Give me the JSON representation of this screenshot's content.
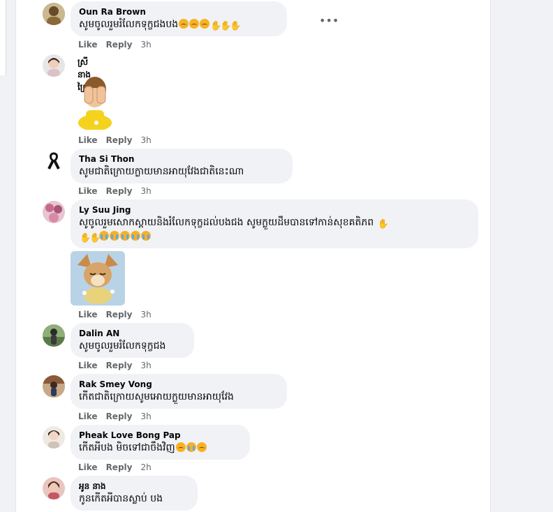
{
  "comments": [
    {
      "name": "Oun Ra Brown",
      "text": "សូមចូលរួមរំលែកទុក្ខជងបង",
      "actions": {
        "like": "Like",
        "reply": "Reply",
        "time": "3h"
      }
    },
    {
      "name": "ស្រីនាង ព្រៃវែង",
      "actions": {
        "like": "Like",
        "reply": "Reply",
        "time": "3h"
      }
    },
    {
      "name": "Tha Si Thon",
      "text": "សូមជាតិក្រោយក្លាយមានអាយុវែងជាតិនេះណា",
      "actions": {
        "like": "Like",
        "reply": "Reply",
        "time": "3h"
      }
    },
    {
      "name": "Ly Suu Jing",
      "text": "សូចូលរួមសោកស្ដាយនិងរំលែកទុក្ខដល់បងជង សូមក្លួយដឹមបានទៅកាន់សុខគតិភព",
      "actions": {
        "like": "Like",
        "reply": "Reply",
        "time": "3h"
      }
    },
    {
      "name": "Dalin AN",
      "text": "សូមចូលរួមរំលែកទុក្ខជង",
      "actions": {
        "like": "Like",
        "reply": "Reply",
        "time": "3h"
      }
    },
    {
      "name": "Rak Smey Vong",
      "text": "កើតជាតិក្រោយសូមអោយក្លួយមានអាយុវែង",
      "actions": {
        "like": "Like",
        "reply": "Reply",
        "time": "3h"
      }
    },
    {
      "name": "Pheak Love Bong Pap",
      "text": "កើតអីបង មិចទៅជាចឹងវិញ",
      "actions": {
        "like": "Like",
        "reply": "Reply",
        "time": "2h"
      }
    },
    {
      "name": "អូន នាង",
      "text": "កូនកើតអីបានស្លាប់ បង"
    }
  ],
  "more_icon": "•••",
  "icons": [
    "more-options-icon",
    "crying-face-icon",
    "praying-hands-icon",
    "loudly-crying-face-icon",
    "black-ribbon-icon"
  ],
  "colors": {
    "bubble": "#f0f2f5",
    "meta": "#65676b",
    "page": "#f0f2f5"
  }
}
